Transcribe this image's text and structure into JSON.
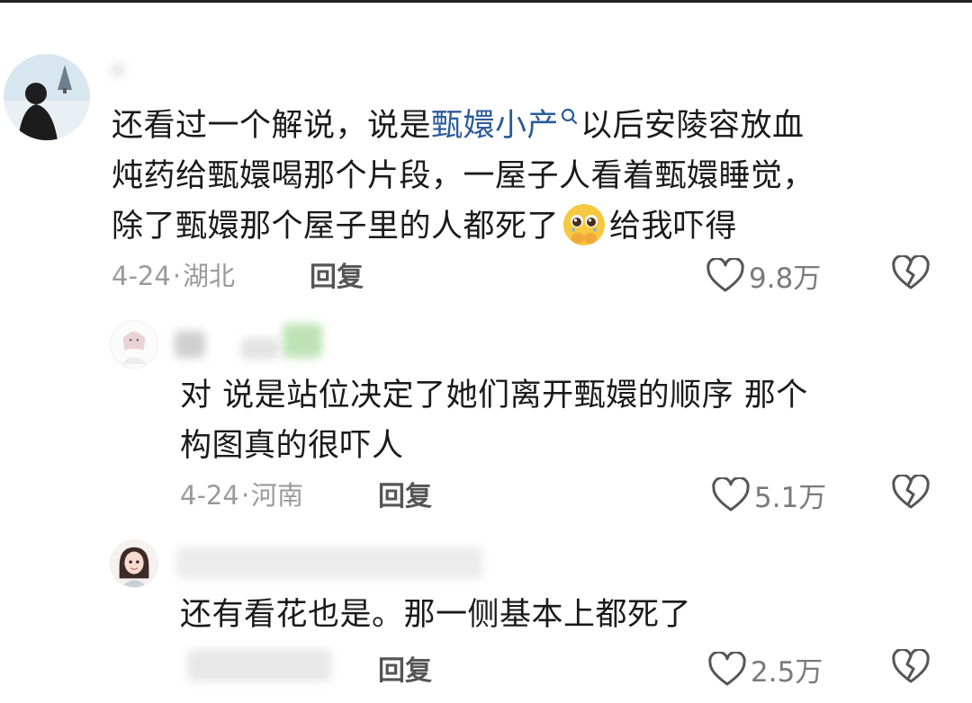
{
  "comments": [
    {
      "text_line1_a": "还看过一个解说，说是",
      "text_line1_link": "甄嬛小产",
      "text_line1_b": "以后安陵容放血",
      "text_line2": "炖药给甄嬛喝那个片段，一屋子人看着甄嬛睡觉，",
      "text_line3_a": "除了甄嬛那个屋子里的人都死了",
      "text_line3_b": "给我吓得",
      "date": "4-24",
      "location": "湖北",
      "reply_label": "回复",
      "likes": "9.8万"
    },
    {
      "text_line1": "对  说是站位决定了她们离开甄嬛的顺序  那个",
      "text_line2": "构图真的很吓人",
      "date": "4-24",
      "location": "河南",
      "reply_label": "回复",
      "likes": "5.1万"
    },
    {
      "text_line1": "还有看花也是。那一侧基本上都死了",
      "reply_label": "回复",
      "likes": "2.5万"
    }
  ],
  "separator": "·",
  "icons": {
    "search": "search-icon",
    "like": "heart-outline-icon",
    "dislike": "broken-heart-icon",
    "emoji": "pleading-face-emoji"
  },
  "colors": {
    "link": "#2b5b9b",
    "meta": "#9a9a9a",
    "icon": "#444444"
  }
}
